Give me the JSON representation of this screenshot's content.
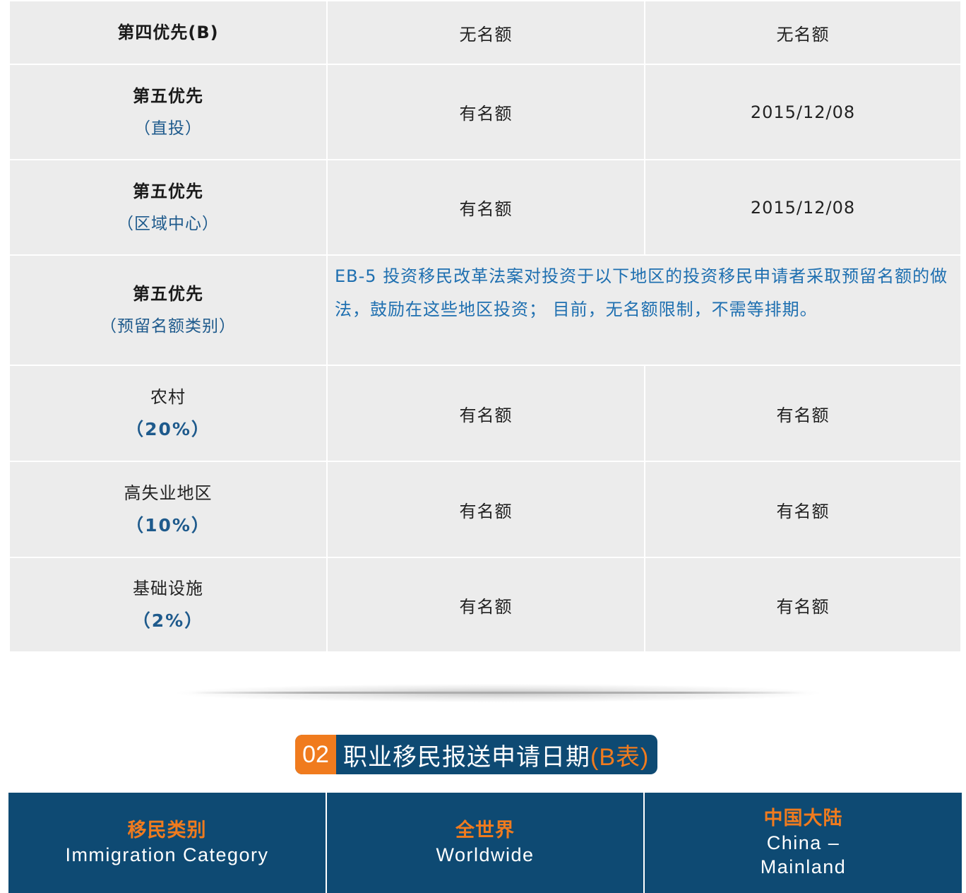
{
  "table_a": {
    "rows": [
      {
        "category": "第四优先(B)",
        "sub": "",
        "worldwide": "无名额",
        "china": "无名额"
      },
      {
        "category": "第五优先",
        "sub": "（直投）",
        "worldwide": "有名额",
        "china": "2015/12/08"
      },
      {
        "category": "第五优先",
        "sub": "（区域中心）",
        "worldwide": "有名额",
        "china": "2015/12/08"
      },
      {
        "category": "第五优先",
        "sub": "（预留名额类别）",
        "note": "EB-5 投资移民改革法案对投资于以下地区的投资移民申请者采取预留名额的做法，鼓励在这些地区投资； 目前，无名额限制，不需等排期。"
      },
      {
        "category": "农村",
        "pct": "（20%）",
        "worldwide": "有名额",
        "china": "有名额"
      },
      {
        "category": "高失业地区",
        "pct": "（10%）",
        "worldwide": "有名额",
        "china": "有名额"
      },
      {
        "category": "基础设施",
        "pct": "（2%）",
        "worldwide": "有名额",
        "china": "有名额"
      }
    ]
  },
  "section": {
    "number": "02",
    "title": "职业移民报送申请日期",
    "title_highlight": "(B表)"
  },
  "table_b": {
    "headers": [
      {
        "zh": "移民类别",
        "en": "Immigration Category"
      },
      {
        "zh": "全世界",
        "en": "Worldwide"
      },
      {
        "zh": "中国大陆",
        "en_line1": "China –",
        "en_line2": "Mainland"
      }
    ]
  },
  "colors": {
    "navy": "#0e4a73",
    "orange": "#f07b1e",
    "link_blue": "#1e5a8c",
    "cell_bg": "#ececec"
  }
}
